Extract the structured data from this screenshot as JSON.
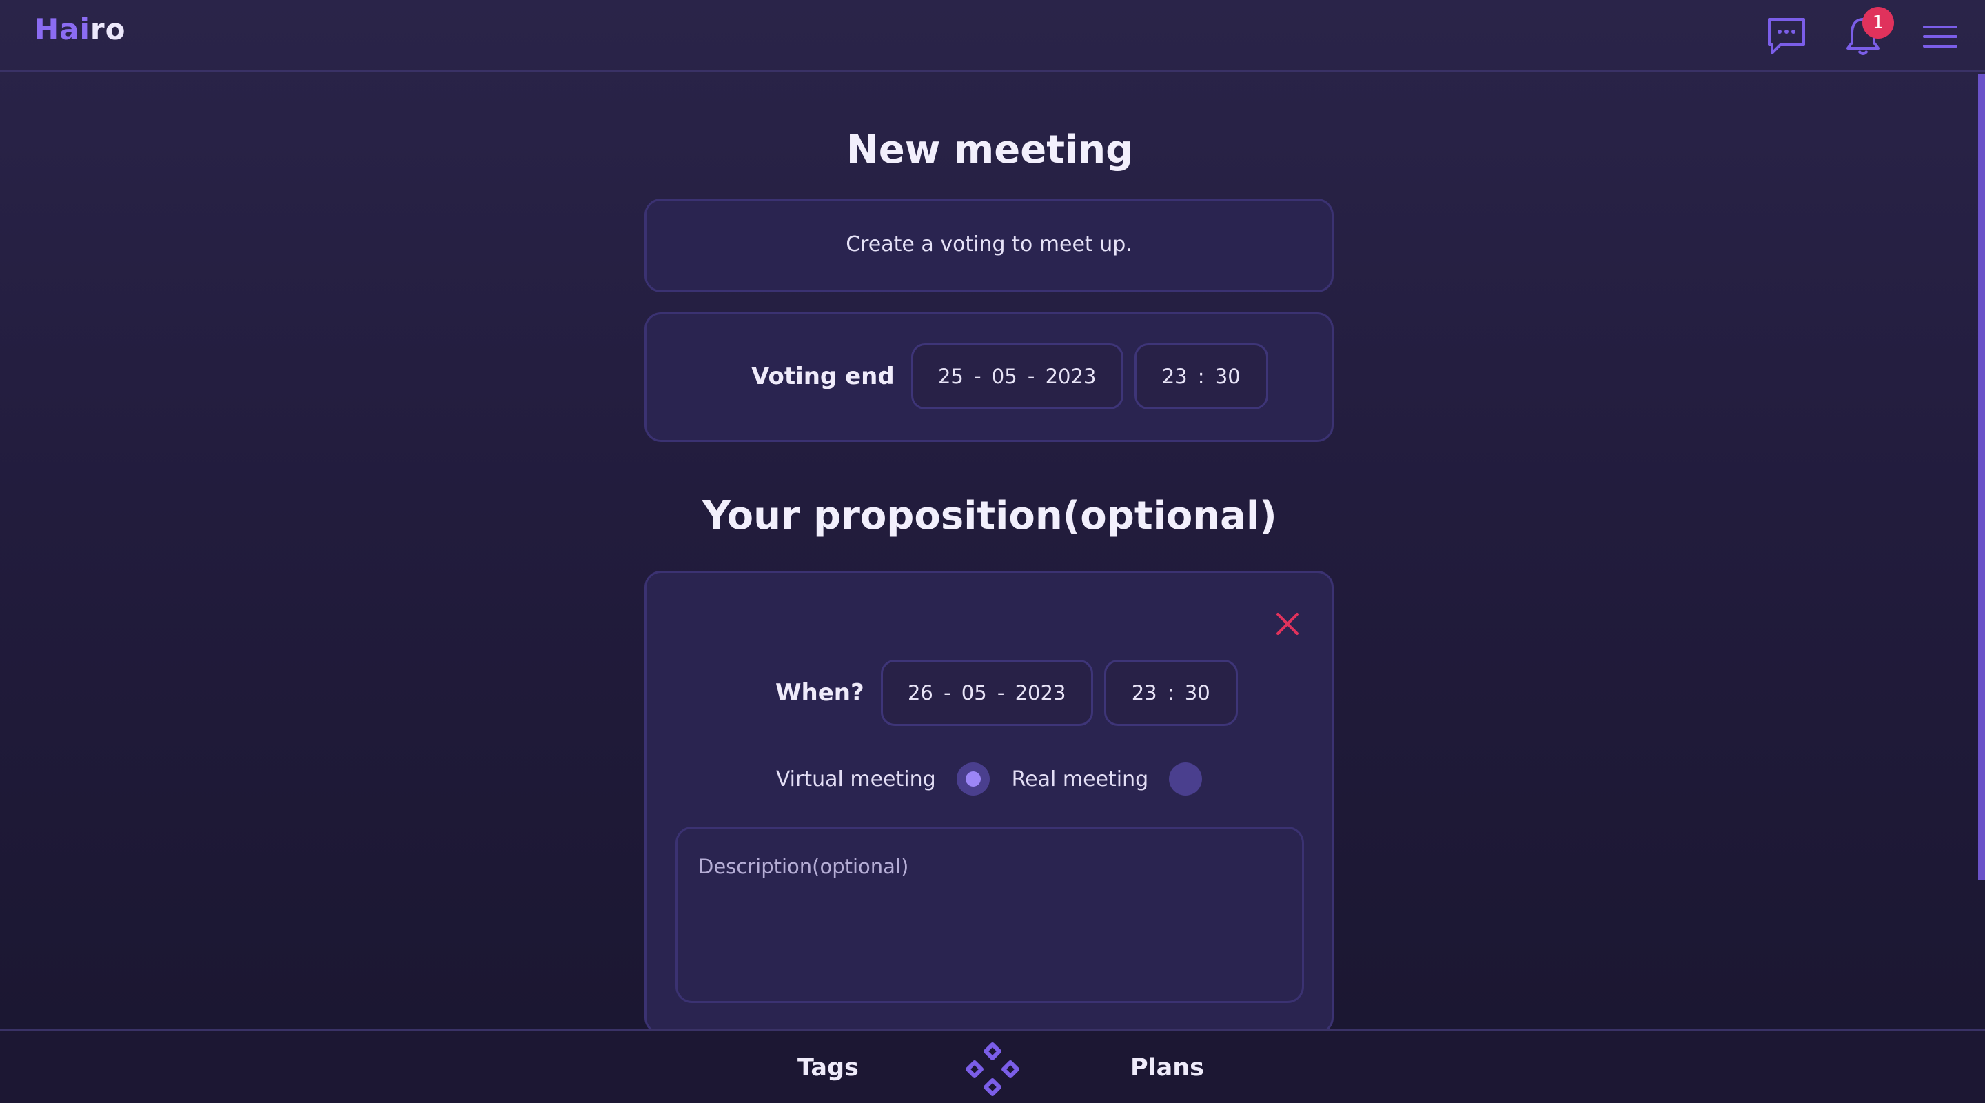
{
  "header": {
    "logo_part1": "Hai",
    "logo_part2": "ro",
    "notification_count": "1"
  },
  "page": {
    "title": "New meeting",
    "subtitle": "Create a voting to meet up.",
    "voting_end": {
      "label": "Voting end",
      "date": "25  -  05  -  2023",
      "time": "23  :  30"
    },
    "proposition_title": "Your proposition(optional)",
    "proposition": {
      "when_label": "When?",
      "date": "26  -  05  -  2023",
      "time": "23  :  30",
      "virtual_label": "Virtual meeting",
      "virtual_selected": true,
      "real_label": "Real meeting",
      "real_selected": false,
      "description_placeholder": "Description(optional)"
    }
  },
  "bottom_nav": {
    "left": "Tags",
    "right": "Plans"
  },
  "colors": {
    "accent": "#8b6cf2",
    "badge": "#e0325c",
    "close": "#e0325c",
    "card": "#2a2450"
  }
}
